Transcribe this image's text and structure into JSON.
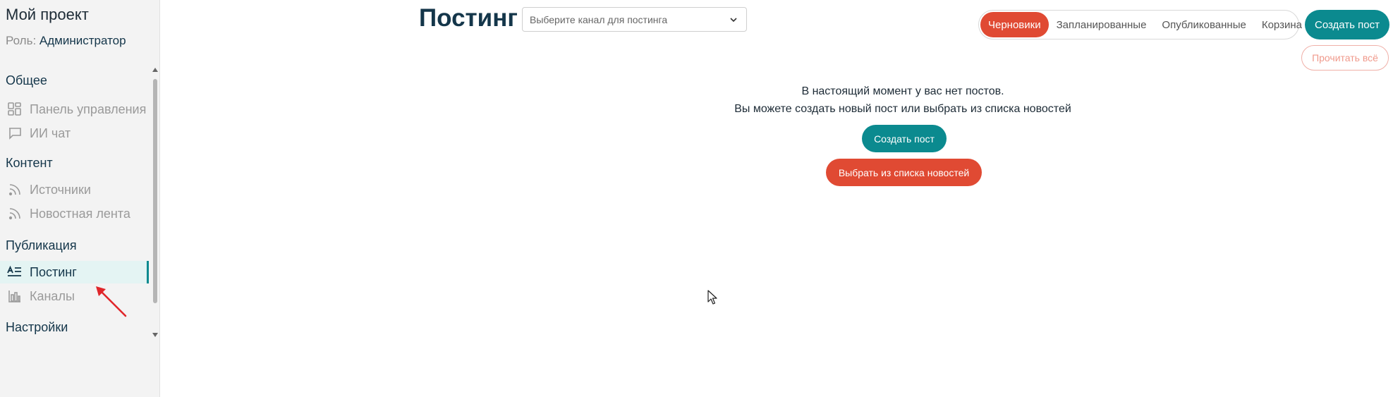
{
  "sidebar": {
    "project_title": "Мой проект",
    "role_label": "Роль:",
    "role_value": "Администратор",
    "sections": [
      {
        "title": "Общее",
        "items": [
          {
            "label": "Панель управления",
            "icon": "dashboard-icon"
          },
          {
            "label": "ИИ чат",
            "icon": "chat-icon"
          }
        ]
      },
      {
        "title": "Контент",
        "items": [
          {
            "label": "Источники",
            "icon": "rss-icon"
          },
          {
            "label": "Новостная лента",
            "icon": "rss-icon"
          }
        ]
      },
      {
        "title": "Публикация",
        "items": [
          {
            "label": "Постинг",
            "icon": "text-align-icon",
            "active": true
          },
          {
            "label": "Каналы",
            "icon": "bar-chart-icon"
          }
        ]
      },
      {
        "title": "Настройки",
        "items": []
      }
    ]
  },
  "header": {
    "title": "Постинг",
    "channel_placeholder": "Выберите канал для постинга",
    "tabs": [
      {
        "label": "Черновики",
        "active": true
      },
      {
        "label": "Запланированные"
      },
      {
        "label": "Опубликованные"
      },
      {
        "label": "Корзина"
      }
    ],
    "create_label": "Создать пост",
    "read_all_label": "Прочитать всё"
  },
  "empty_state": {
    "line1": "В настоящий момент у вас нет постов.",
    "line2": "Вы можете создать новый пост или выбрать из списка новостей",
    "create_label": "Создать пост",
    "news_label": "Выбрать из списка новостей"
  },
  "colors": {
    "accent": "#0b8a8f",
    "danger": "#e04a33",
    "sidebar_bg": "#f3f3f3",
    "active_item_bg": "#e4f4f3"
  }
}
